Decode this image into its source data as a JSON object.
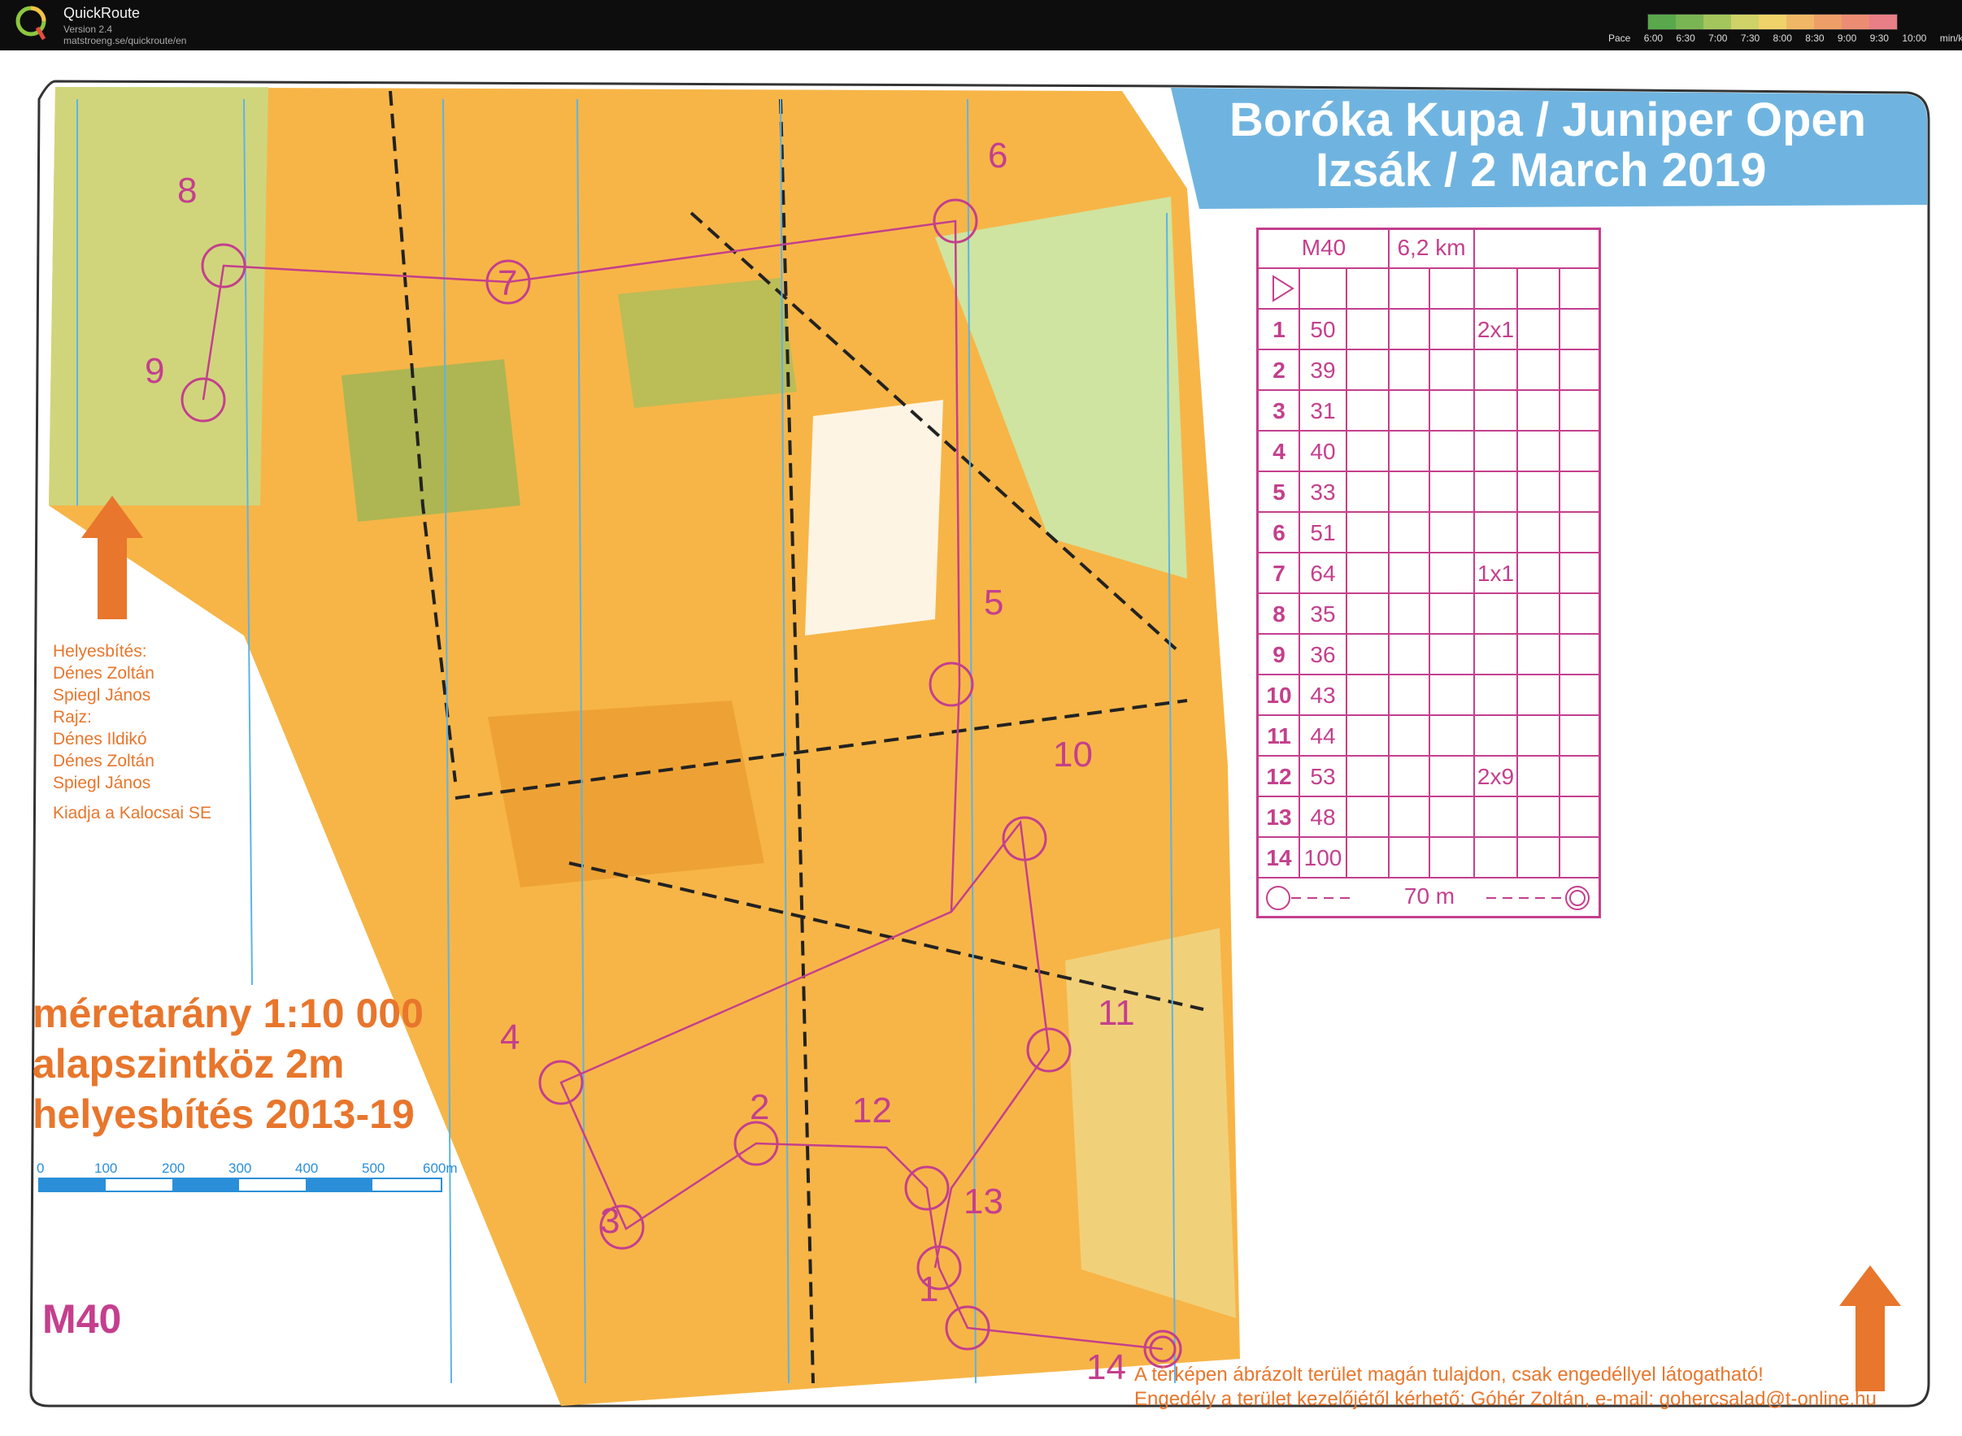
{
  "app": {
    "name": "QuickRoute",
    "version": "Version 2.4",
    "url": "matstroeng.se/quickroute/en",
    "pace_prefix": "Pace",
    "pace_ticks": [
      "6:00",
      "6:30",
      "7:00",
      "7:30",
      "8:00",
      "8:30",
      "9:00",
      "9:30",
      "10:00"
    ],
    "pace_unit": "min/km",
    "pace_colors": [
      "#59a84b",
      "#7ab553",
      "#a4c55b",
      "#cfd267",
      "#f0d26a",
      "#f0b866",
      "#ee9f68",
      "#ec8c72",
      "#e87e86"
    ]
  },
  "map": {
    "title_line1": "Boróka Kupa / Juniper Open",
    "title_line2": "Izsák /  2 March 2019",
    "north_arrow_icon": "north-arrow-icon",
    "credits": [
      "Helyesbítés:",
      "Dénes Zoltán",
      "Spiegl János",
      "Rajz:",
      "Dénes Ildikó",
      "Dénes Zoltán",
      "Spiegl János",
      "Kiadja a Kalocsai SE"
    ],
    "scale_text": "méretarány 1:10 000",
    "contour_text": "alapszintköz 2m",
    "revision_text": "helyesbítés 2013-19",
    "scale_bar_labels": [
      "0",
      "100",
      "200",
      "300",
      "400",
      "500",
      "600m"
    ],
    "category": "M40",
    "start_label": "14",
    "notice_line1": "A térképen ábrázolt terület magán tulajdon, csak engedéllyel látogatható!",
    "notice_line2": "Engedély a terület kezelőjétől kérhető: Góhér Zoltán, e-mail: gohercsalad@t-online.hu",
    "colors": {
      "orange": "#e8762c",
      "magenta": "#c43f8d",
      "title_blue": "#6fb4e0",
      "green": "#9ccc65",
      "yellow": "#f4a83a"
    }
  },
  "control_description": {
    "class": "M40",
    "length": "6,2 km",
    "finish_distance": "70 m",
    "rows": [
      {
        "num": "1",
        "code": "50",
        "extra": "2x1"
      },
      {
        "num": "2",
        "code": "39",
        "extra": ""
      },
      {
        "num": "3",
        "code": "31",
        "extra": ""
      },
      {
        "num": "4",
        "code": "40",
        "extra": ""
      },
      {
        "num": "5",
        "code": "33",
        "extra": ""
      },
      {
        "num": "6",
        "code": "51",
        "extra": ""
      },
      {
        "num": "7",
        "code": "64",
        "extra": "1x1"
      },
      {
        "num": "8",
        "code": "35",
        "extra": ""
      },
      {
        "num": "9",
        "code": "36",
        "extra": ""
      },
      {
        "num": "10",
        "code": "43",
        "extra": ""
      },
      {
        "num": "11",
        "code": "44",
        "extra": ""
      },
      {
        "num": "12",
        "code": "53",
        "extra": "2x9"
      },
      {
        "num": "13",
        "code": "48",
        "extra": ""
      },
      {
        "num": "14",
        "code": "100",
        "extra": ""
      }
    ]
  },
  "controls": [
    "1",
    "2",
    "3",
    "4",
    "5",
    "6",
    "7",
    "8",
    "9",
    "10",
    "11",
    "12",
    "13"
  ]
}
